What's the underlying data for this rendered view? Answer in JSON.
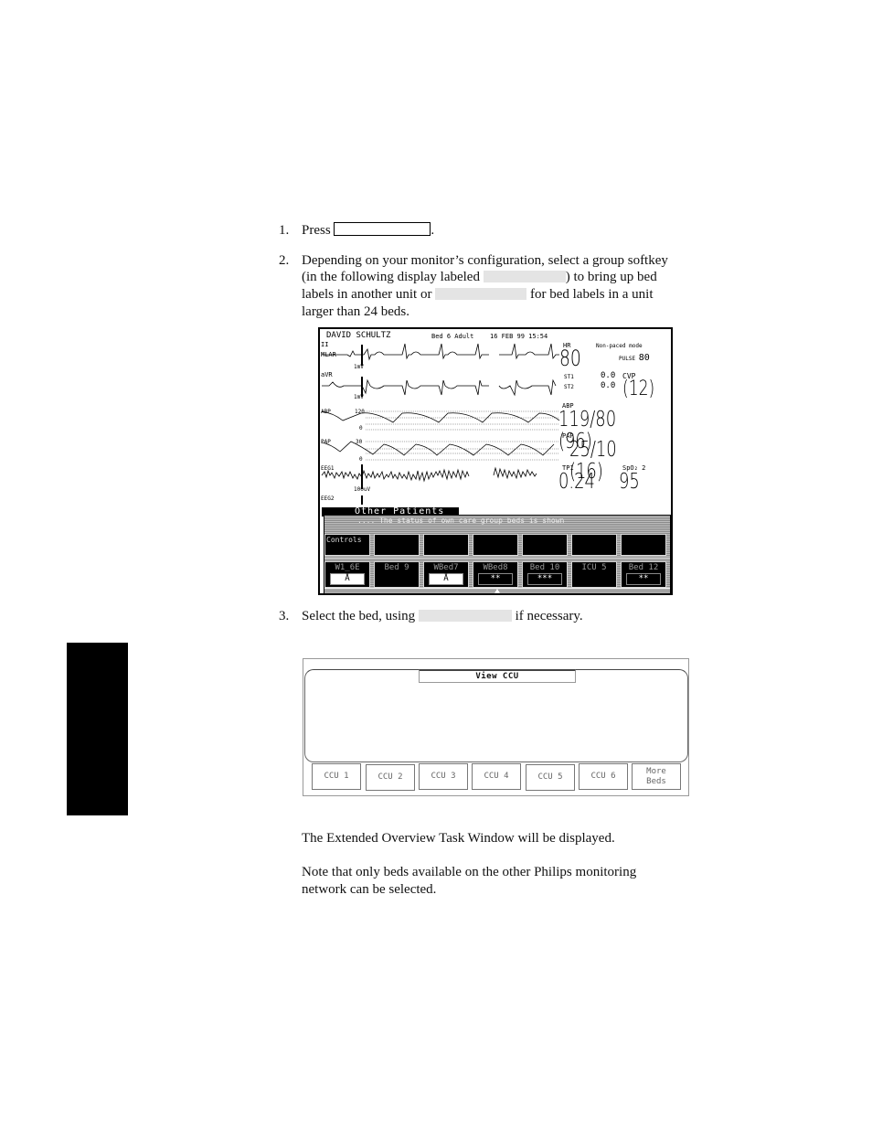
{
  "steps": [
    {
      "number": "1.",
      "prefix": "Press",
      "suffix": "."
    },
    {
      "number": "2.",
      "line1": "Depending on your monitor’s configuration, select a group softkey",
      "line2a": "(in the following display labeled",
      "line2b": ") to bring up bed",
      "line3a": "labels in another unit or",
      "line3b": "for bed labels in a unit",
      "line4": "larger than 24 beds."
    },
    {
      "number": "3.",
      "prefix": "Select the bed, using",
      "suffix": "if necessary."
    }
  ],
  "monitor": {
    "patient_name": "DAVID SCHULTZ",
    "bed_info": "Bed  6 Adult",
    "date_time": "16 FEB 99 15:54",
    "waves": [
      {
        "label": "II",
        "sublabel": "MLAR",
        "scale": "1mV"
      },
      {
        "label": "aVR",
        "sublabel": "",
        "scale": "1mV"
      },
      {
        "label": "ABP",
        "top": "120",
        "bottom": "0"
      },
      {
        "label": "PAP",
        "top": "30",
        "bottom": "0"
      },
      {
        "label": "EEG1",
        "sublabel": "",
        "scale": "100uV"
      },
      {
        "label": "EEG2"
      }
    ],
    "params": {
      "hr_label": "HR",
      "hr_value": "80",
      "pace_mode": "Non-paced mode",
      "pulse_label": "PULSE",
      "pulse_value": "80",
      "st1_label": "ST1",
      "st1_value": "0.0",
      "st2_label": "ST2",
      "st2_value": "0.0",
      "cvp_label": "CVP",
      "cvp_value": "(12)",
      "abp_label": "ABP",
      "abp_value": "119/80 (96)",
      "pap_label": "PAP",
      "pap_value": "25/10 (16)",
      "tp1_label": "TP1",
      "tp1_value": "0.24",
      "spo2_label": "SpO₂  2",
      "spo2_value": "95"
    },
    "panel": {
      "tab_label": "Other Patients",
      "status_message": ".... The status of own care group beds is shown",
      "controls_label": "Controls",
      "beds": [
        {
          "label": "W1_6E",
          "value": "Å",
          "highlight": true
        },
        {
          "label": "Bed  9",
          "value": "",
          "highlight": false
        },
        {
          "label": "WBed7",
          "value": "Å",
          "highlight": true
        },
        {
          "label": "WBed8",
          "value": "**",
          "highlight": false
        },
        {
          "label": "Bed 10",
          "value": "***",
          "highlight": false
        },
        {
          "label": "ICU 5",
          "value": "",
          "highlight": false
        },
        {
          "label": "Bed 12",
          "value": "**",
          "highlight": false
        }
      ]
    }
  },
  "ccu_window": {
    "title": "View CCU",
    "buttons": [
      "CCU 1",
      "CCU 2",
      "CCU 3",
      "CCU 4",
      "CCU 5",
      "CCU 6",
      "More\nBeds"
    ]
  },
  "notes": {
    "line1": "The Extended Overview Task Window will be displayed.",
    "line2a": "Note that only beds available on the other Philips monitoring",
    "line2b": "network can be selected."
  }
}
